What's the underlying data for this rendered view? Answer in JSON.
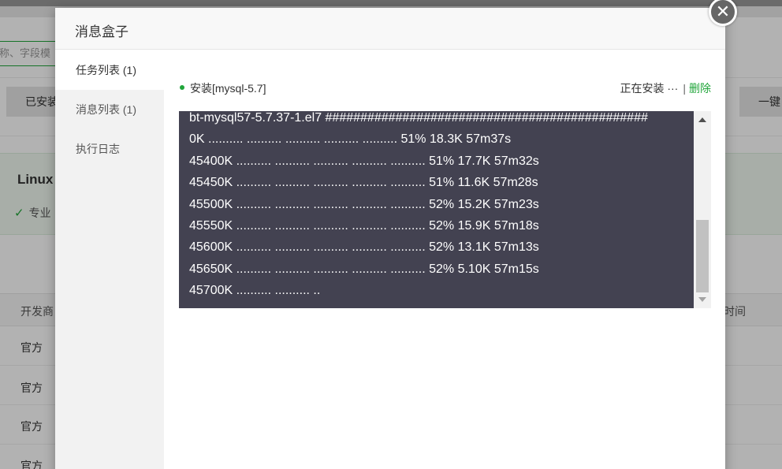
{
  "background": {
    "search_placeholder": "称、字段模",
    "btn_left": "已安装",
    "btn_right": "一键",
    "banner_title": "Linux",
    "banner_sub": "专业",
    "th_left": "开发商",
    "th_right": "时间",
    "rows": [
      "官方",
      "官方",
      "官方",
      "官方"
    ]
  },
  "dialog": {
    "title": "消息盒子",
    "close_glyph": "✕",
    "sidebar": [
      {
        "label": "任务列表 (1)"
      },
      {
        "label": "消息列表 (1)"
      },
      {
        "label": "执行日志"
      }
    ],
    "task": {
      "name": "安装[mysql-5.7]",
      "status": "正在安装 ···",
      "separator": "|",
      "delete_label": "删除"
    },
    "log_lines": [
      "bt-mysql57-5.7.37-1.el7 ##############################################",
      "0K .......... .......... .......... .......... .......... 51% 18.3K 57m37s",
      "45400K .......... .......... .......... .......... .......... 51% 17.7K 57m32s",
      "45450K .......... .......... .......... .......... .......... 51% 11.6K 57m28s",
      "45500K .......... .......... .......... .......... .......... 52% 15.2K 57m23s",
      "45550K .......... .......... .......... .......... .......... 52% 15.9K 57m18s",
      "45600K .......... .......... .......... .......... .......... 52% 13.1K 57m13s",
      "45650K .......... .......... .......... .......... .......... 52% 5.10K 57m15s",
      "45700K .......... .......... .."
    ]
  },
  "colors": {
    "accent": "#20a53a",
    "log_bg": "#434251"
  }
}
